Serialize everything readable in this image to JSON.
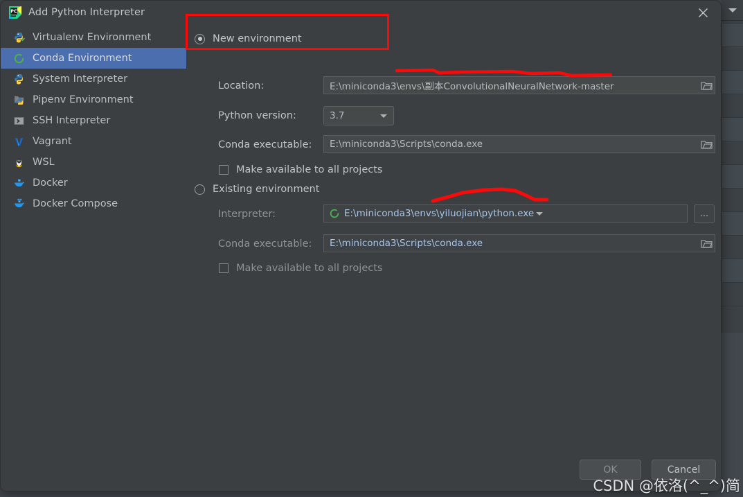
{
  "window": {
    "title": "Add Python Interpreter",
    "app_icon": "pycharm-logo-icon",
    "close_icon": "close-icon"
  },
  "sidebar": {
    "items": [
      {
        "label": "Virtualenv Environment",
        "icon": "python-venv-icon",
        "selected": false
      },
      {
        "label": "Conda Environment",
        "icon": "conda-ring-icon",
        "selected": true
      },
      {
        "label": "System Interpreter",
        "icon": "python-icon",
        "selected": false
      },
      {
        "label": "Pipenv Environment",
        "icon": "pipenv-folder-icon",
        "selected": false
      },
      {
        "label": "SSH Interpreter",
        "icon": "terminal-icon",
        "selected": false
      },
      {
        "label": "Vagrant",
        "icon": "vagrant-v-icon",
        "selected": false
      },
      {
        "label": "WSL",
        "icon": "linux-penguin-icon",
        "selected": false
      },
      {
        "label": "Docker",
        "icon": "docker-whale-icon",
        "selected": false
      },
      {
        "label": "Docker Compose",
        "icon": "docker-compose-icon",
        "selected": false
      }
    ]
  },
  "main": {
    "new_environment": {
      "radio_label": "New environment",
      "selected": true,
      "location_label": "Location:",
      "location_value": "E:\\miniconda3\\envs\\副本ConvolutionalNeuralNetwork-master",
      "location_browse_icon": "folder-icon",
      "python_version_label": "Python version:",
      "python_version_value": "3.7",
      "python_version_options": [
        "3.7"
      ],
      "conda_exe_label": "Conda executable:",
      "conda_exe_value": "E:\\miniconda3\\Scripts\\conda.exe",
      "conda_browse_icon": "folder-icon",
      "make_available_label": "Make available to all projects",
      "make_available_checked": false
    },
    "existing_environment": {
      "radio_label": "Existing environment",
      "selected": false,
      "interpreter_label": "Interpreter:",
      "interpreter_value": "E:\\miniconda3\\envs\\yiluojian\\python.exe",
      "interpreter_icon": "conda-ring-icon",
      "interpreter_dropdown_icon": "chevron-down-icon",
      "interpreter_more_label": "...",
      "conda_exe_label": "Conda executable:",
      "conda_exe_value": "E:\\miniconda3\\Scripts\\conda.exe",
      "conda_browse_icon": "folder-icon",
      "make_available_label": "Make available to all projects",
      "make_available_checked": false
    }
  },
  "footer": {
    "ok_label": "OK",
    "ok_enabled": false,
    "cancel_label": "Cancel"
  },
  "annotations": {
    "highlight_color": "#fb0a0a",
    "rect_target": "New environment",
    "underline_targets": [
      "location_value",
      "interpreter_value"
    ]
  },
  "watermark": {
    "text": "CSDN @依洛(^_^)简"
  },
  "colors": {
    "dialog_bg": "#3c3f41",
    "selection_blue": "#4b6eaf",
    "field_bg": "#45494a",
    "annotation_red": "#fb0a0a"
  }
}
